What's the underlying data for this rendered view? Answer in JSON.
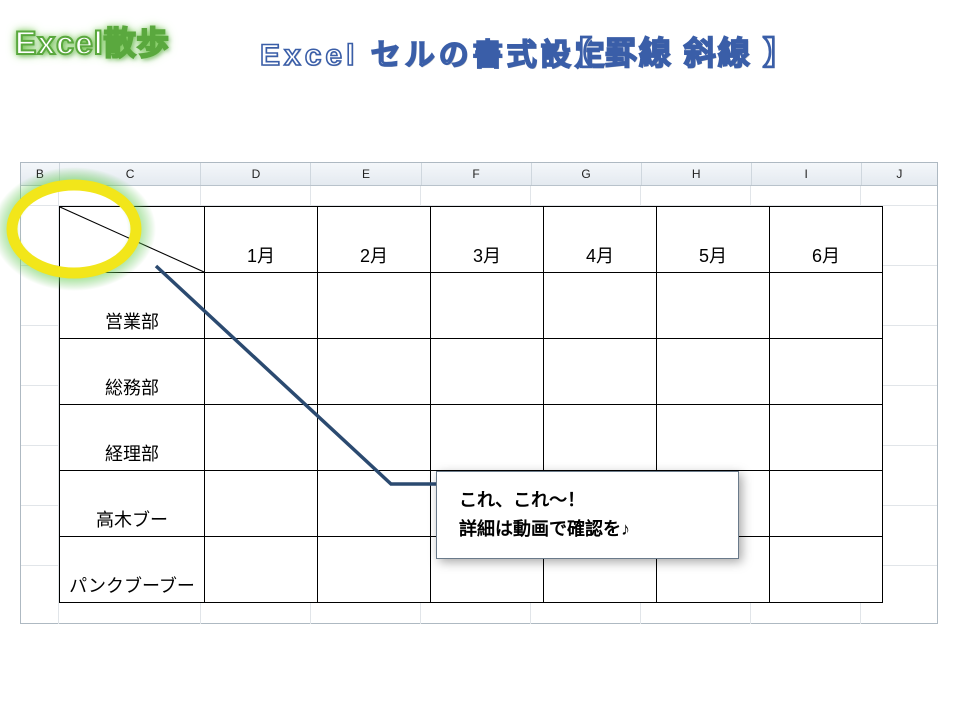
{
  "brand": "Excel散歩",
  "title": "Excel  セルの書式設定",
  "subtitle": "【 罫線 斜線 】",
  "columns": [
    "B",
    "C",
    "D",
    "E",
    "F",
    "G",
    "H",
    "I",
    "J"
  ],
  "table": {
    "header_row": [
      "",
      "1月",
      "2月",
      "3月",
      "4月",
      "5月",
      "6月"
    ],
    "rows": [
      [
        "営業部",
        "",
        "",
        "",
        "",
        "",
        ""
      ],
      [
        "総務部",
        "",
        "",
        "",
        "",
        "",
        ""
      ],
      [
        "経理部",
        "",
        "",
        "",
        "",
        "",
        ""
      ],
      [
        "高木ブー",
        "",
        "",
        "",
        "",
        "",
        ""
      ],
      [
        "パンクブーブー",
        "",
        "",
        "",
        "",
        "",
        ""
      ]
    ]
  },
  "callout": {
    "line1": "これ、これ～！",
    "line2": "詳細は動画で確認を♪"
  }
}
